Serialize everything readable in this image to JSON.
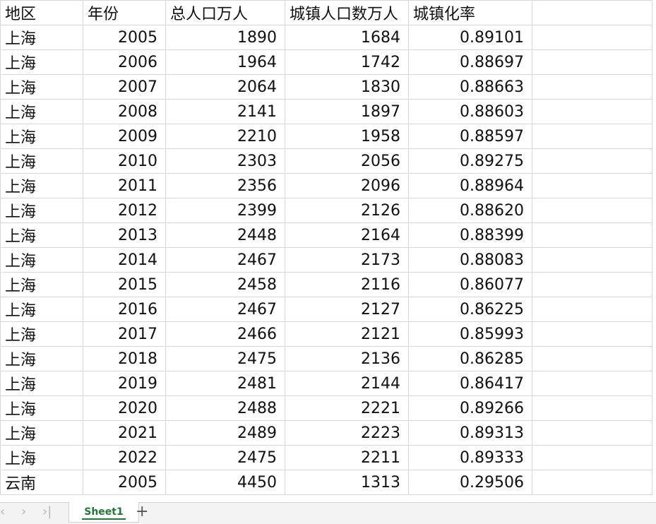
{
  "sheet": {
    "headers": [
      "地区",
      "年份",
      "总人口万人",
      "城镇人口数万人",
      "城镇化率",
      ""
    ],
    "rows": [
      [
        "上海",
        "2005",
        "1890",
        "1684",
        "0.89101"
      ],
      [
        "上海",
        "2006",
        "1964",
        "1742",
        "0.88697"
      ],
      [
        "上海",
        "2007",
        "2064",
        "1830",
        "0.88663"
      ],
      [
        "上海",
        "2008",
        "2141",
        "1897",
        "0.88603"
      ],
      [
        "上海",
        "2009",
        "2210",
        "1958",
        "0.88597"
      ],
      [
        "上海",
        "2010",
        "2303",
        "2056",
        "0.89275"
      ],
      [
        "上海",
        "2011",
        "2356",
        "2096",
        "0.88964"
      ],
      [
        "上海",
        "2012",
        "2399",
        "2126",
        "0.88620"
      ],
      [
        "上海",
        "2013",
        "2448",
        "2164",
        "0.88399"
      ],
      [
        "上海",
        "2014",
        "2467",
        "2173",
        "0.88083"
      ],
      [
        "上海",
        "2015",
        "2458",
        "2116",
        "0.86077"
      ],
      [
        "上海",
        "2016",
        "2467",
        "2127",
        "0.86225"
      ],
      [
        "上海",
        "2017",
        "2466",
        "2121",
        "0.85993"
      ],
      [
        "上海",
        "2018",
        "2475",
        "2136",
        "0.86285"
      ],
      [
        "上海",
        "2019",
        "2481",
        "2144",
        "0.86417"
      ],
      [
        "上海",
        "2020",
        "2488",
        "2221",
        "0.89266"
      ],
      [
        "上海",
        "2021",
        "2489",
        "2223",
        "0.89313"
      ],
      [
        "上海",
        "2022",
        "2475",
        "2211",
        "0.89333"
      ],
      [
        "云南",
        "2005",
        "4450",
        "1313",
        "0.29506"
      ]
    ]
  },
  "tabbar": {
    "first_icon": "first-sheet-icon",
    "prev_icon": "prev-sheet-icon",
    "next_icon": "next-sheet-icon",
    "last_icon": "last-sheet-icon",
    "active_tab": "Sheet1",
    "add_icon": "add-sheet-icon"
  },
  "colors": {
    "tab_accent": "#1f7a3a",
    "grid_line": "#d6d6d6"
  }
}
